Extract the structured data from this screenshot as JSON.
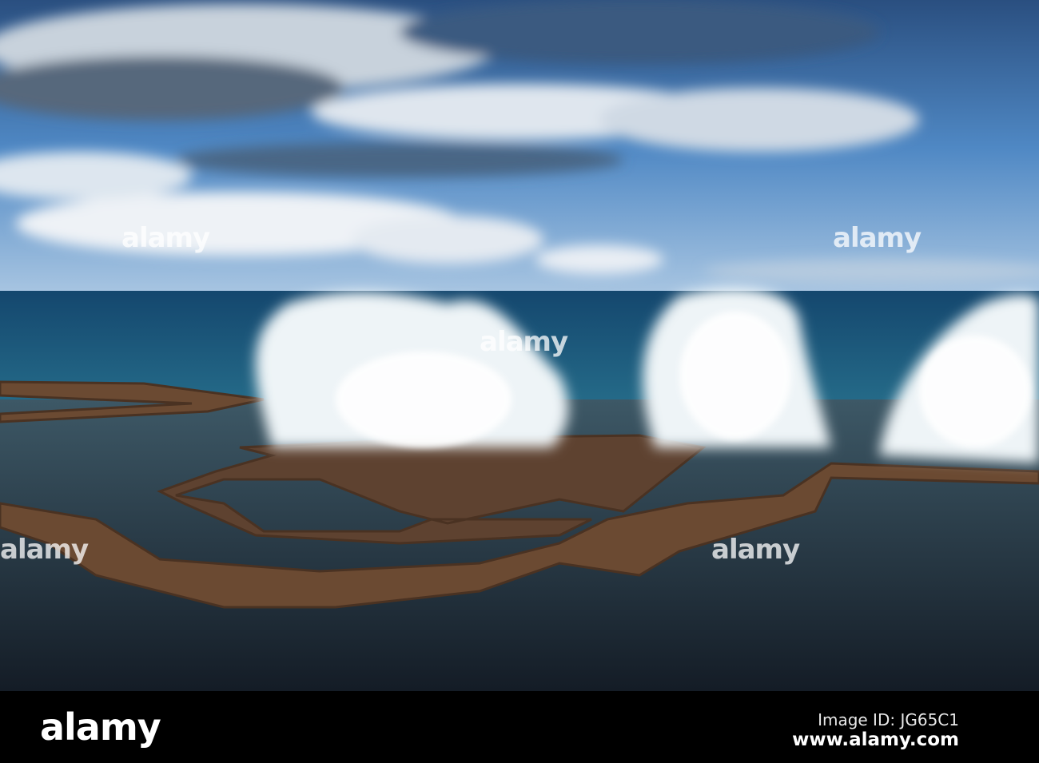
{
  "photo": {
    "subject": "blowholes",
    "colors": {
      "sky": "#3f78b8",
      "ocean": "#1f5f86",
      "pool": "#1c2630",
      "rock": "#6b4a32",
      "spray": "#f2f6f8"
    }
  },
  "watermark": {
    "text": "alamy"
  },
  "footer": {
    "logo": "alamy",
    "image_id": "Image ID: JG65C1",
    "website": "www.alamy.com"
  }
}
